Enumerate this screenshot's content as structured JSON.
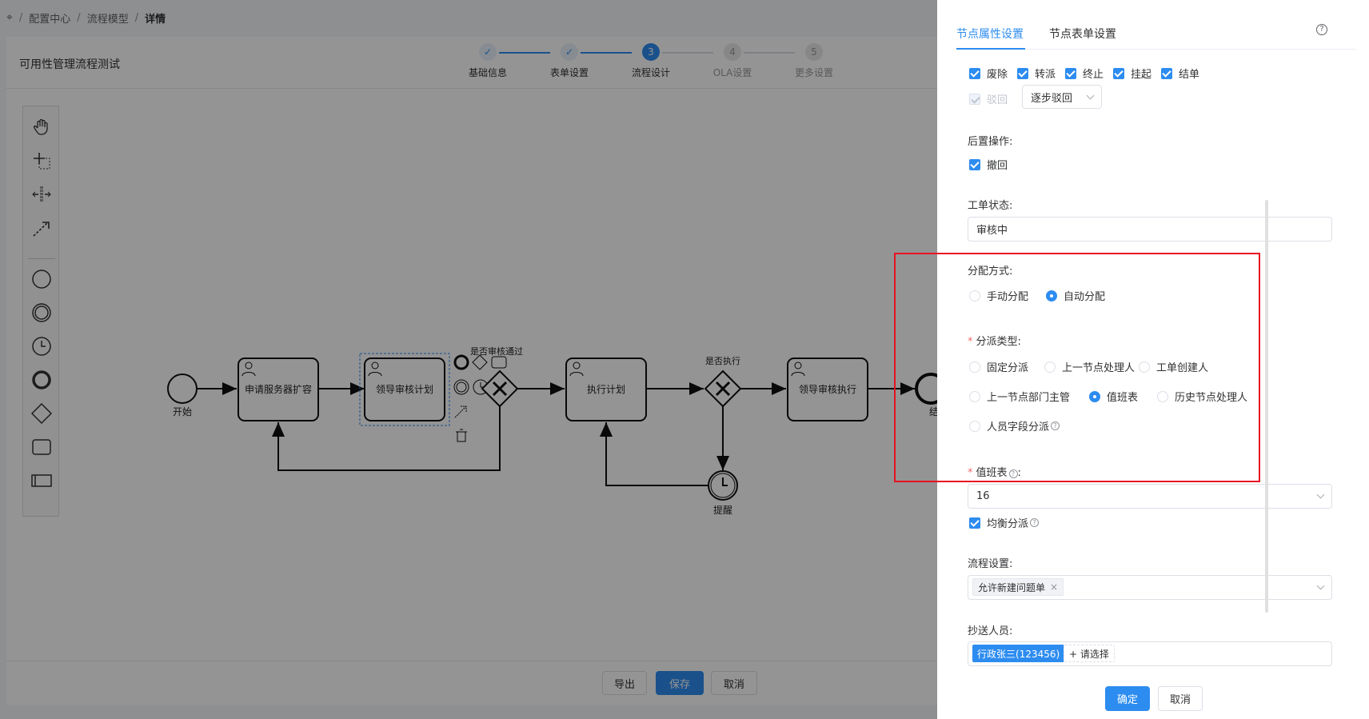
{
  "breadcrumb": {
    "items": [
      "配置中心",
      "流程模型"
    ],
    "current": "详情"
  },
  "process_title": "可用性管理流程测试",
  "steps": [
    {
      "num": "✓",
      "label": "基础信息",
      "state": "done"
    },
    {
      "num": "✓",
      "label": "表单设置",
      "state": "done"
    },
    {
      "num": "3",
      "label": "流程设计",
      "state": "active"
    },
    {
      "num": "4",
      "label": "OLA设置",
      "state": "wait"
    },
    {
      "num": "5",
      "label": "更多设置",
      "state": "wait"
    }
  ],
  "diagram": {
    "start_label": "开始",
    "task1": "申请服务器扩容",
    "task2": "领导审核计划",
    "gateway1_label": "是否审核通过",
    "task3": "执行计划",
    "gateway2_label": "是否执行",
    "task4": "领导审核执行",
    "timer_label": "提醒",
    "end_label_partial": "结"
  },
  "footer": {
    "export": "导出",
    "save": "保存",
    "cancel": "取消"
  },
  "panel": {
    "tabs": [
      "节点属性设置",
      "节点表单设置"
    ],
    "help": "?",
    "ops": [
      "废除",
      "转派",
      "终止",
      "挂起",
      "结单"
    ],
    "reject_label": "驳回",
    "reject_mode": "逐步驳回",
    "post_op_label": "后置操作:",
    "post_op_item": "撤回",
    "status_label": "工单状态:",
    "status_value": "审核中",
    "assign_label": "分配方式:",
    "assign_manual": "手动分配",
    "assign_auto": "自动分配",
    "dispatch_label": "分派类型:",
    "dispatch_opts": [
      "固定分派",
      "上一节点处理人",
      "工单创建人",
      "上一节点部门主管",
      "值班表",
      "历史节点处理人",
      "人员字段分派"
    ],
    "duty_label": "值班表",
    "duty_value": "16",
    "balance_label": "均衡分派",
    "flow_label": "流程设置:",
    "flow_tag": "允许新建问题单",
    "cc_label": "抄送人员:",
    "cc_tag": "行政张三(123456)",
    "cc_add": "+ 请选择",
    "confirm": "确定",
    "cancel": "取消"
  },
  "colors": {
    "primary": "#2d8cf0",
    "highlight": "#e81123"
  }
}
